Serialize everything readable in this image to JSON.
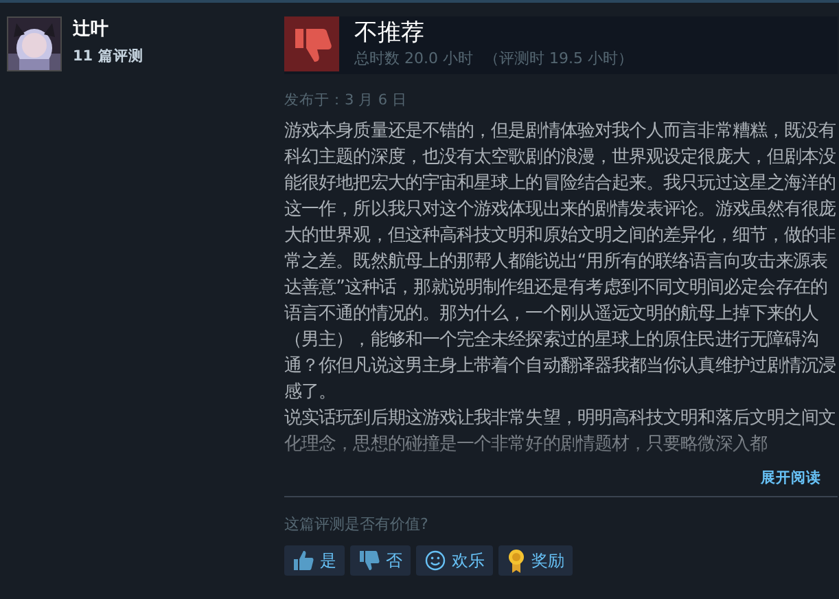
{
  "author": {
    "name": "辻叶",
    "review_count": "11 篇评测"
  },
  "review": {
    "verdict": "不推荐",
    "recommended": false,
    "hours": "总时数 20.0 小时",
    "hours_at_review": "（评测时 19.5 小时）",
    "posted": "发布于：3 月 6 日",
    "paragraphs": [
      "游戏本身质量还是不错的，但是剧情体验对我个人而言非常糟糕，既没有科幻主题的深度，也没有太空歌剧的浪漫，世界观设定很庞大，但剧本没能很好地把宏大的宇宙和星球上的冒险结合起来。我只玩过这星之海洋的这一作，所以我只对这个游戏体现出来的剧情发表评论。游戏虽然有很庞大的世界观，但这种高科技文明和原始文明之间的差异化，细节，做的非常之差。既然航母上的那帮人都能说出“用所有的联络语言向攻击来源表达善意”这种话，那就说明制作组还是有考虑到不同文明间必定会存在的语言不通的情况的。那为什么，一个刚从遥远文明的航母上掉下来的人（男主），能够和一个完全未经探索过的星球上的原住民进行无障碍沟通？你但凡说这男主身上带着个自动翻译器我都当你认真维护过剧情沉浸感了。",
      "说实话玩到后期这游戏让我非常失望，明明高科技文明和落后文明之间文化理念，思想的碰撞是一个非常好的剧情题材，只要略微深入都"
    ],
    "expand": "展开阅读",
    "question": "这篇评测是否有价值?",
    "buttons": [
      {
        "kind": "yes",
        "label": "是"
      },
      {
        "kind": "no",
        "label": "否"
      },
      {
        "kind": "funny",
        "label": "欢乐"
      },
      {
        "kind": "award",
        "label": "奖励"
      }
    ]
  }
}
